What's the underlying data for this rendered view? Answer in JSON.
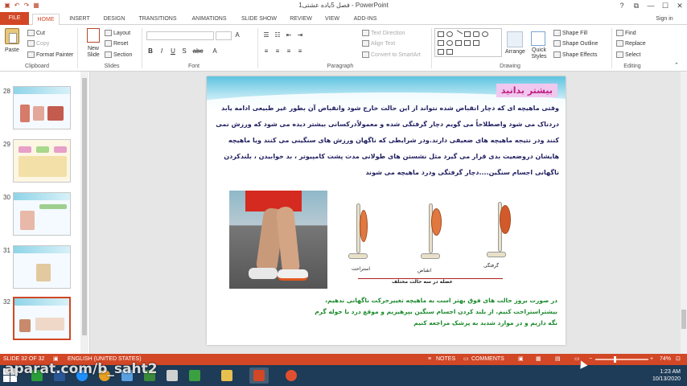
{
  "window": {
    "title": "فصل 5یاده عشتی1 - PowerPoint",
    "controls": [
      "?",
      "⧉",
      "—",
      "☐",
      "✕"
    ]
  },
  "tabs": [
    "FILE",
    "HOME",
    "INSERT",
    "DESIGN",
    "TRANSITIONS",
    "ANIMATIONS",
    "SLIDE SHOW",
    "REVIEW",
    "VIEW",
    "ADD-INS"
  ],
  "active_tab": "HOME",
  "sign_in": "Sign in",
  "ribbon": {
    "clipboard": {
      "paste": "Paste",
      "cut": "Cut",
      "copy": "Copy",
      "format_painter": "Format Painter",
      "label": "Clipboard"
    },
    "slides": {
      "new_slide": "New Slide",
      "layout": "Layout",
      "reset": "Reset",
      "section": "Section",
      "label": "Slides"
    },
    "font": {
      "label": "Font",
      "bold": "B",
      "italic": "I",
      "underline": "U",
      "strike": "S",
      "abc": "abc"
    },
    "paragraph": {
      "label": "Paragraph",
      "text_direction": "Text Direction",
      "align_text": "Align Text",
      "smartart": "Convert to SmartArt"
    },
    "drawing": {
      "label": "Drawing",
      "arrange": "Arrange",
      "quick_styles": "Quick Styles",
      "shape_fill": "Shape Fill",
      "shape_outline": "Shape Outline",
      "shape_effects": "Shape Effects"
    },
    "editing": {
      "label": "Editing",
      "find": "Find",
      "replace": "Replace",
      "select": "Select"
    }
  },
  "thumbnails": [
    {
      "num": "28"
    },
    {
      "num": "29"
    },
    {
      "num": "30"
    },
    {
      "num": "31"
    },
    {
      "num": "32"
    }
  ],
  "slide": {
    "title": "بیشتر بدانید",
    "body": "وقتی ماهیچه ای که دچار انقباض شده نتواند از این حالت خارج شود وانقباض آن بطور غیر طبیعی ادامه یابد دردناک می شود واصطلاحاً می گویم دچار گرفتگی شده و معمولاًدرکسانی بیشتر دیده می شود که ورزش نمی کنند ودر نتیجه ماهیچه های ضعیفی دارند.ودر شرایطی که ناگهان ورزش های سنگینی می کنند ویا ماهیچه هایشان دروضعیت بدی قرار می گیرد مثل نشستن های طولانی مدت پشت کامپیوتر ، بد خوابیدن ، بلندکردن ناگهانی اجسام سنگین....دچار گرفتگی ودرد ماهیچه می شوند",
    "labels": {
      "relax": "استراحت",
      "contract": "انقباض",
      "cramp": "گرفتگی",
      "caption": "عضله در سه حالت مختلف"
    },
    "note": "در صورت بروز حالت های فوق بهتر است به ماهیچه تغییرحرکت ناگهانی ندهیم، بیشتراستراحت کنیم. از بلند کردن اجسام سنگین بپرهیزیم و موقع درد با حوله گرم نگه داریم و در موارد شدید به پزشک مراجعه کنیم"
  },
  "status": {
    "slide_info": "SLIDE 32 OF 32",
    "language": "ENGLISH (UNITED STATES)",
    "notes": "NOTES",
    "comments": "COMMENTS",
    "zoom": "74%"
  },
  "taskbar": {
    "time": "1:23 AM",
    "date": "10/13/2020"
  },
  "watermark": "aparat.com/b_saht2",
  "colors": {
    "accent": "#d24726",
    "taskbar": "#1e3b57",
    "slide_title_bg": "#f0c8ef",
    "note_text": "#1a8a2a"
  }
}
